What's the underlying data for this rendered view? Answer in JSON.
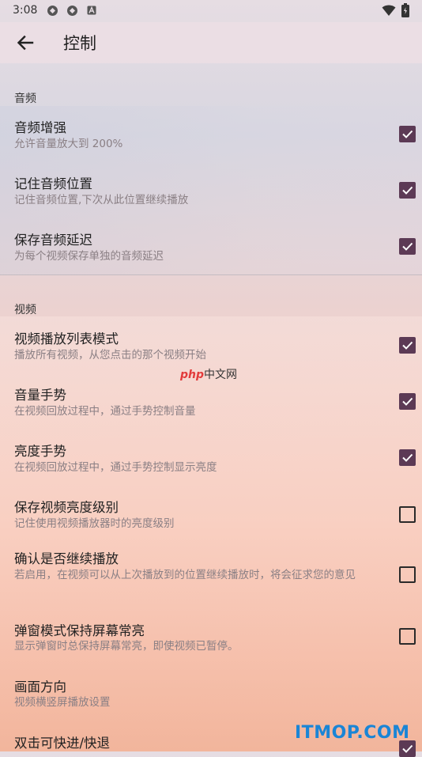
{
  "status_bar": {
    "time": "3:08",
    "icons": [
      "app-notification-icon",
      "app-notification-icon",
      "a-badge-icon",
      "wifi-icon",
      "battery-icon"
    ]
  },
  "app_bar": {
    "title": "控制",
    "back_icon": "arrow-left-icon"
  },
  "sections": {
    "audio": {
      "header": "音频",
      "items": [
        {
          "title": "音频增强",
          "summary": "允许音量放大到 200%",
          "checked": true
        },
        {
          "title": "记住音频位置",
          "summary": "记住音频位置,下次从此位置继续播放",
          "checked": true
        },
        {
          "title": "保存音频延迟",
          "summary": "为每个视频保存单独的音频延迟",
          "checked": true
        }
      ]
    },
    "video": {
      "header": "视频",
      "items": [
        {
          "title": "视频播放列表模式",
          "summary": "播放所有视频，从您点击的那个视频开始",
          "checked": true
        },
        {
          "title": "音量手势",
          "summary": "在视频回放过程中，通过手势控制音量",
          "checked": true
        },
        {
          "title": "亮度手势",
          "summary": "在视频回放过程中，通过手势控制显示亮度",
          "checked": true
        },
        {
          "title": "保存视频亮度级别",
          "summary": "记住使用视频播放器时的亮度级别",
          "checked": false
        },
        {
          "title": "确认是否继续播放",
          "summary": "若启用，在视频可以从上次播放到的位置继续播放时，将会征求您的意见",
          "checked": false
        },
        {
          "title": "弹窗模式保持屏幕常亮",
          "summary": "显示弹窗时总保持屏幕常亮，即使视频已暂停。",
          "checked": false
        },
        {
          "title": "画面方向",
          "summary": "视频横竖屏播放设置"
        },
        {
          "title": "双击可快进/快退",
          "checked": true
        }
      ]
    }
  },
  "watermarks": {
    "php_part": "php",
    "cn_part": "中文网",
    "itmop": "ITMOP.COM"
  },
  "colors": {
    "checkbox_checked": "#5c3a55",
    "checkbox_unchecked_border": "#2a2a2a",
    "summary_text": "#8a7f84",
    "itmop_watermark": "#1a85d6",
    "php_watermark": "#e23b3b"
  }
}
